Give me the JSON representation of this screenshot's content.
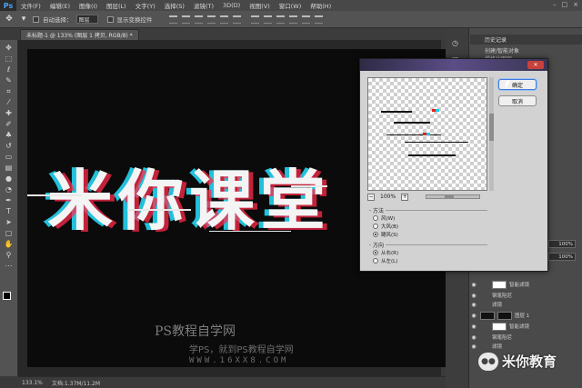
{
  "app": {
    "logo": "Ps",
    "menu": [
      "文件(F)",
      "编辑(E)",
      "图像(I)",
      "图层(L)",
      "文字(Y)",
      "选择(S)",
      "滤镜(T)",
      "3D(D)",
      "视图(V)",
      "窗口(W)",
      "帮助(H)"
    ],
    "window_controls": [
      "–",
      "□",
      "×"
    ]
  },
  "options_bar": {
    "auto_select_label": "自动选择：",
    "auto_select_value": "图层",
    "show_transform_label": "显示变换控件"
  },
  "document": {
    "tab_title": "未标题-1 @ 133% (图层 1 拷贝, RGB/8) *",
    "zoom": "133.1%",
    "doc_info": "文档:1.37M/11.2M"
  },
  "canvas": {
    "headline": "米你课堂",
    "watermark_title": "PS教程自学网",
    "watermark_sub": "学PS，就到PS教程自学网",
    "watermark_url": "WWW.16XX8.COM"
  },
  "right_panel": {
    "history_title": "历史记录",
    "history_items": [
      "创建/智能对象",
      "栅格化图层"
    ],
    "opacity_value": "100%",
    "fill_value": "100%",
    "layers": [
      {
        "name": "智能滤镜",
        "thumb": "white",
        "indent": true
      },
      {
        "name": "钢笔阻尼",
        "thumb": "none",
        "indent": true
      },
      {
        "name": "滤镜",
        "thumb": "none",
        "indent": true
      },
      {
        "name": "图层 1",
        "thumb": "black",
        "indent": false
      },
      {
        "name": "智能滤镜",
        "thumb": "white",
        "indent": true
      },
      {
        "name": "钢笔阻尼",
        "thumb": "none",
        "indent": true
      },
      {
        "name": "滤镜",
        "thumb": "none",
        "indent": true
      }
    ]
  },
  "wind_dialog": {
    "ok_label": "确定",
    "cancel_label": "取消",
    "zoom_value": "100%",
    "zoom_minus": "−",
    "zoom_plus": "+",
    "method_title": "方法",
    "method_options": [
      "风(W)",
      "大风(B)",
      "飓风(S)"
    ],
    "method_selected": 2,
    "direction_title": "方向",
    "direction_options": [
      "从右(R)",
      "从左(L)"
    ],
    "direction_selected": 0
  },
  "wechat": {
    "icon": "wechat-icon",
    "label": "米你教育"
  },
  "colors": {
    "canvas_bg": "#0b0b0b",
    "glitch_cyan": "#27e0ff",
    "glitch_red": "#ff2a4a",
    "ok_border": "#3d7ad9"
  }
}
